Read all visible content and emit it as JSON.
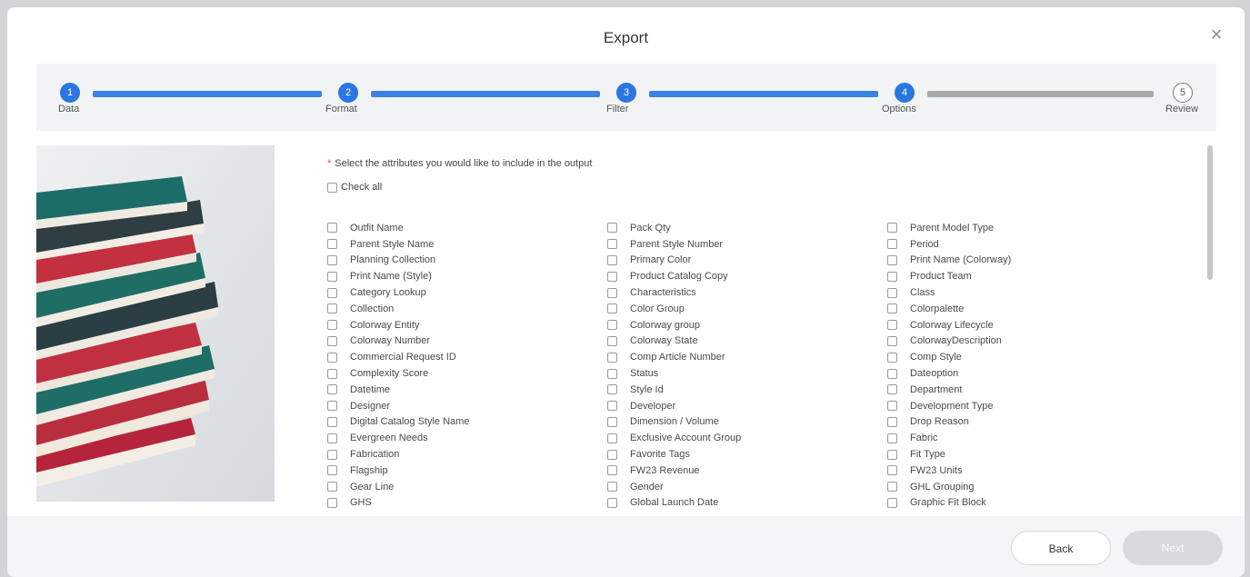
{
  "dialog": {
    "title": "Export",
    "close_glyph": "×"
  },
  "stepper": {
    "steps": [
      {
        "number": "1",
        "label": "Data",
        "state": "done"
      },
      {
        "number": "2",
        "label": "Format",
        "state": "done"
      },
      {
        "number": "3",
        "label": "Filter",
        "state": "done"
      },
      {
        "number": "4",
        "label": "Options",
        "state": "done"
      },
      {
        "number": "5",
        "label": "Review",
        "state": "todo"
      }
    ],
    "colors": {
      "active": "#3a82e6",
      "inactive": "#a8a8a8"
    }
  },
  "form": {
    "required_mark": "*",
    "instruction": "Select the attributes you would like to include in the output",
    "check_all": "Check all",
    "columns": [
      [
        "Outfit Name",
        "Parent Style Name",
        "Planning Collection",
        "Print Name (Style)",
        "Category Lookup",
        "Collection",
        "Colorway Entity",
        "Colorway Number",
        "Commercial Request ID",
        "Complexity Score",
        "Datetime",
        "Designer",
        "Digital Catalog Style Name",
        "Evergreen Needs",
        "Fabrication",
        "Flagship",
        "Gear Line",
        "GHS"
      ],
      [
        "Pack Qty",
        "Parent Style Number",
        "Primary Color",
        "Product Catalog Copy",
        "Characteristics",
        "Color Group",
        "Colorway group",
        "Colorway State",
        "Comp Article Number",
        "Status",
        "Style Id",
        "Developer",
        "Dimension / Volume",
        "Exclusive Account Group",
        "Favorite Tags",
        "FW23 Revenue",
        "Gender",
        "Global Launch Date"
      ],
      [
        "Parent Model Type",
        "Period",
        "Print Name (Colorway)",
        "Product Team",
        "Class",
        "Colorpalette",
        "Colorway Lifecycle",
        "ColorwayDescription",
        "Comp Style",
        "Dateoption",
        "Department",
        "Development Type",
        "Drop Reason",
        "Fabric",
        "Fit Type",
        "FW23 Units",
        "GHL Grouping",
        "Graphic Fit Block"
      ]
    ]
  },
  "footer": {
    "back_label": "Back",
    "next_label": "Next"
  }
}
